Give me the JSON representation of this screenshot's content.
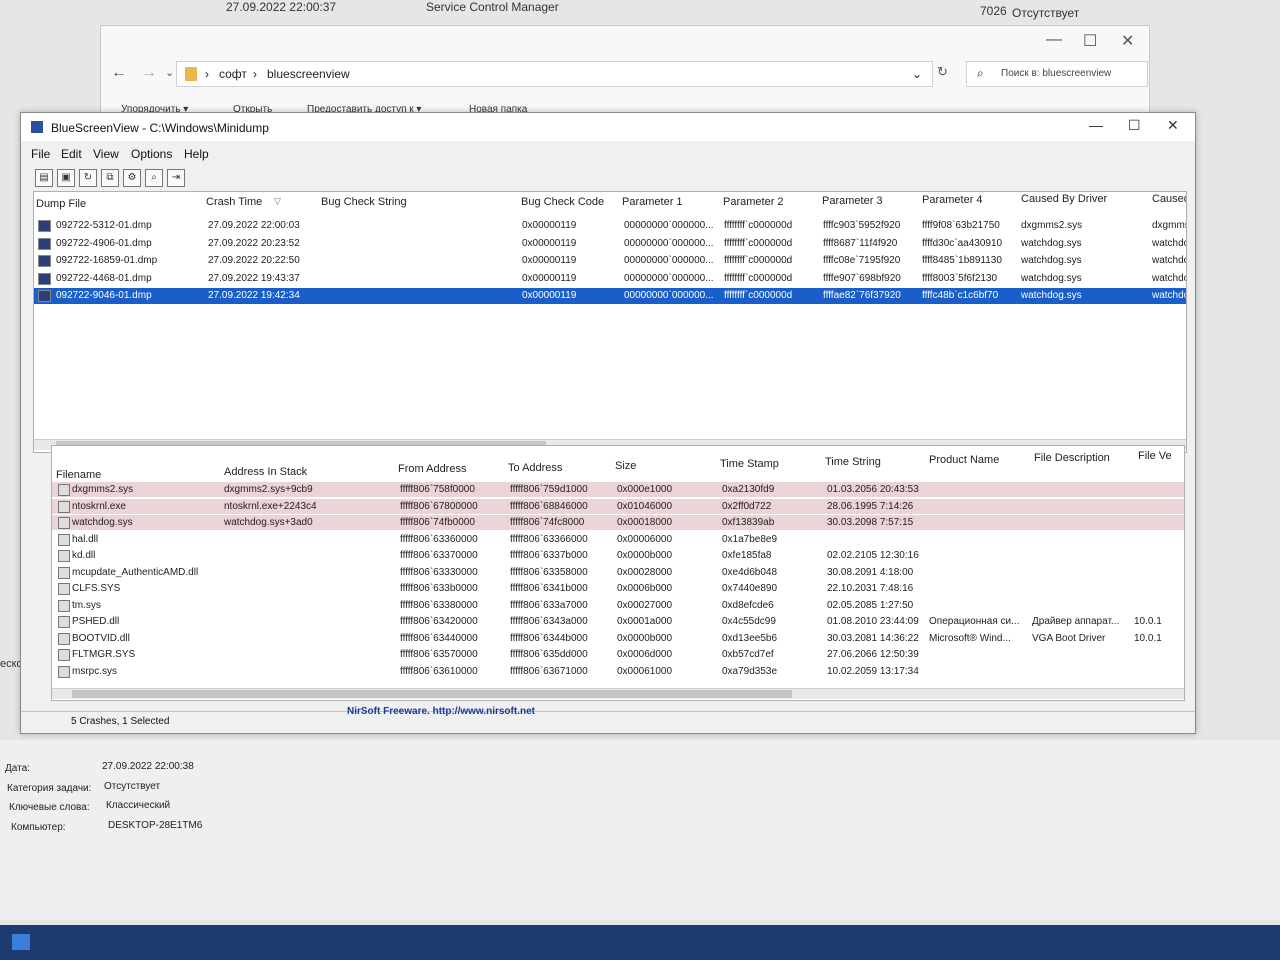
{
  "background": {
    "top_row": {
      "date": "27.09.2022 22:00:37",
      "source": "Service Control Manager",
      "event_id": "7026",
      "category": "Отсутствует"
    },
    "left_fragment": "еской ошибк",
    "details": {
      "date_label": "Дата:",
      "date_value": "27.09.2022 22:00:38",
      "task_label": "Категория задачи:",
      "task_value": "Отсутствует",
      "keywords_label": "Ключевые слова:",
      "keywords_value": "Классический",
      "computer_label": "Компьютер:",
      "computer_value": "DESKTOP-28E1TM6"
    }
  },
  "explorer": {
    "breadcrumb": [
      "софт",
      "bluescreenview"
    ],
    "search_placeholder": "Поиск в: bluescreenview",
    "ribbon": [
      "Упорядочить ▾",
      "Открыть",
      "Предоставить доступ к ▾",
      "Новая папка"
    ]
  },
  "app": {
    "title": "BlueScreenView - C:\\Windows\\Minidump",
    "menu": [
      "File",
      "Edit",
      "View",
      "Options",
      "Help"
    ],
    "toolbar_icons": [
      "properties-icon",
      "save-icon",
      "refresh-icon",
      "copy-icon",
      "advanced-options-icon",
      "find-icon",
      "exit-icon"
    ],
    "upper_columns": [
      "Dump File",
      "Crash Time",
      "Bug Check String",
      "Bug Check Code",
      "Parameter 1",
      "Parameter 2",
      "Parameter 3",
      "Parameter 4",
      "Caused By Driver",
      "Caused B"
    ],
    "dumps": [
      {
        "file": "092722-5312-01.dmp",
        "time": "27.09.2022 22:00:03",
        "code": "0x00000119",
        "p1": "00000000`000000...",
        "p2": "ffffffff`c000000d",
        "p3": "ffffc903`5952f920",
        "p4": "ffff9f08`63b21750",
        "driver": "dxgmms2.sys",
        "driver2": "dxgmms"
      },
      {
        "file": "092722-4906-01.dmp",
        "time": "27.09.2022 20:23:52",
        "code": "0x00000119",
        "p1": "00000000`000000...",
        "p2": "ffffffff`c000000d",
        "p3": "ffff8687`11f4f920",
        "p4": "ffffd30c`aa430910",
        "driver": "watchdog.sys",
        "driver2": "watchdo"
      },
      {
        "file": "092722-16859-01.dmp",
        "time": "27.09.2022 20:22:50",
        "code": "0x00000119",
        "p1": "00000000`000000...",
        "p2": "ffffffff`c000000d",
        "p3": "ffffc08e`7195f920",
        "p4": "ffff8485`1b891130",
        "driver": "watchdog.sys",
        "driver2": "watchdo"
      },
      {
        "file": "092722-4468-01.dmp",
        "time": "27.09.2022 19:43:37",
        "code": "0x00000119",
        "p1": "00000000`000000...",
        "p2": "ffffffff`c000000d",
        "p3": "ffffe907`698bf920",
        "p4": "ffff8003`5f6f2130",
        "driver": "watchdog.sys",
        "driver2": "watchdo"
      },
      {
        "file": "092722-9046-01.dmp",
        "time": "27.09.2022 19:42:34",
        "code": "0x00000119",
        "p1": "00000000`000000...",
        "p2": "ffffffff`c000000d",
        "p3": "ffffae82`76f37920",
        "p4": "ffffc48b`c1c6bf70",
        "driver": "watchdog.sys",
        "driver2": "watchdo"
      }
    ],
    "selected_index": 4,
    "lower_columns": [
      "Filename",
      "Address In Stack",
      "From Address",
      "To Address",
      "Size",
      "Time Stamp",
      "Time String",
      "Product Name",
      "File Description",
      "File Ve"
    ],
    "modules": [
      {
        "name": "dxgmms2.sys",
        "stack": "dxgmms2.sys+9cb9",
        "from": "fffff806`758f0000",
        "to": "fffff806`759d1000",
        "size": "0x000e1000",
        "stamp": "0xa2130fd9",
        "tstr": "01.03.2056 20:43:53",
        "product": "",
        "desc": "",
        "ver": "",
        "hl": true
      },
      {
        "name": "ntoskrnl.exe",
        "stack": "ntoskrnl.exe+2243c4",
        "from": "fffff806`67800000",
        "to": "fffff806`68846000",
        "size": "0x01046000",
        "stamp": "0x2ff0d722",
        "tstr": "28.06.1995 7:14:26",
        "product": "",
        "desc": "",
        "ver": "",
        "hl": true
      },
      {
        "name": "watchdog.sys",
        "stack": "watchdog.sys+3ad0",
        "from": "fffff806`74fb0000",
        "to": "fffff806`74fc8000",
        "size": "0x00018000",
        "stamp": "0xf13839ab",
        "tstr": "30.03.2098 7:57:15",
        "product": "",
        "desc": "",
        "ver": "",
        "hl": true
      },
      {
        "name": "hal.dll",
        "stack": "",
        "from": "fffff806`63360000",
        "to": "fffff806`63366000",
        "size": "0x00006000",
        "stamp": "0x1a7be8e9",
        "tstr": "",
        "product": "",
        "desc": "",
        "ver": "",
        "hl": false
      },
      {
        "name": "kd.dll",
        "stack": "",
        "from": "fffff806`63370000",
        "to": "fffff806`6337b000",
        "size": "0x0000b000",
        "stamp": "0xfe185fa8",
        "tstr": "02.02.2105 12:30:16",
        "product": "",
        "desc": "",
        "ver": "",
        "hl": false
      },
      {
        "name": "mcupdate_AuthenticAMD.dll",
        "stack": "",
        "from": "fffff806`63330000",
        "to": "fffff806`63358000",
        "size": "0x00028000",
        "stamp": "0xe4d6b048",
        "tstr": "30.08.2091 4:18:00",
        "product": "",
        "desc": "",
        "ver": "",
        "hl": false
      },
      {
        "name": "CLFS.SYS",
        "stack": "",
        "from": "fffff806`633b0000",
        "to": "fffff806`6341b000",
        "size": "0x0006b000",
        "stamp": "0x7440e890",
        "tstr": "22.10.2031 7:48:16",
        "product": "",
        "desc": "",
        "ver": "",
        "hl": false
      },
      {
        "name": "tm.sys",
        "stack": "",
        "from": "fffff806`63380000",
        "to": "fffff806`633a7000",
        "size": "0x00027000",
        "stamp": "0xd8efcde6",
        "tstr": "02.05.2085 1:27:50",
        "product": "",
        "desc": "",
        "ver": "",
        "hl": false
      },
      {
        "name": "PSHED.dll",
        "stack": "",
        "from": "fffff806`63420000",
        "to": "fffff806`6343a000",
        "size": "0x0001a000",
        "stamp": "0x4c55dc99",
        "tstr": "01.08.2010 23:44:09",
        "product": "Операционная си...",
        "desc": "Драйвер аппарат...",
        "ver": "10.0.1",
        "hl": false
      },
      {
        "name": "BOOTVID.dll",
        "stack": "",
        "from": "fffff806`63440000",
        "to": "fffff806`6344b000",
        "size": "0x0000b000",
        "stamp": "0xd13ee5b6",
        "tstr": "30.03.2081 14:36:22",
        "product": "Microsoft® Wind...",
        "desc": "VGA Boot Driver",
        "ver": "10.0.1",
        "hl": false
      },
      {
        "name": "FLTMGR.SYS",
        "stack": "",
        "from": "fffff806`63570000",
        "to": "fffff806`635dd000",
        "size": "0x0006d000",
        "stamp": "0xb57cd7ef",
        "tstr": "27.06.2066 12:50:39",
        "product": "",
        "desc": "",
        "ver": "",
        "hl": false
      },
      {
        "name": "msrpc.sys",
        "stack": "",
        "from": "fffff806`63610000",
        "to": "fffff806`63671000",
        "size": "0x00061000",
        "stamp": "0xa79d353e",
        "tstr": "10.02.2059 13:17:34",
        "product": "",
        "desc": "",
        "ver": "",
        "hl": false
      }
    ],
    "status": "5 Crashes, 1 Selected",
    "nirsoft": "NirSoft Freeware.  http://www.nirsoft.net"
  }
}
